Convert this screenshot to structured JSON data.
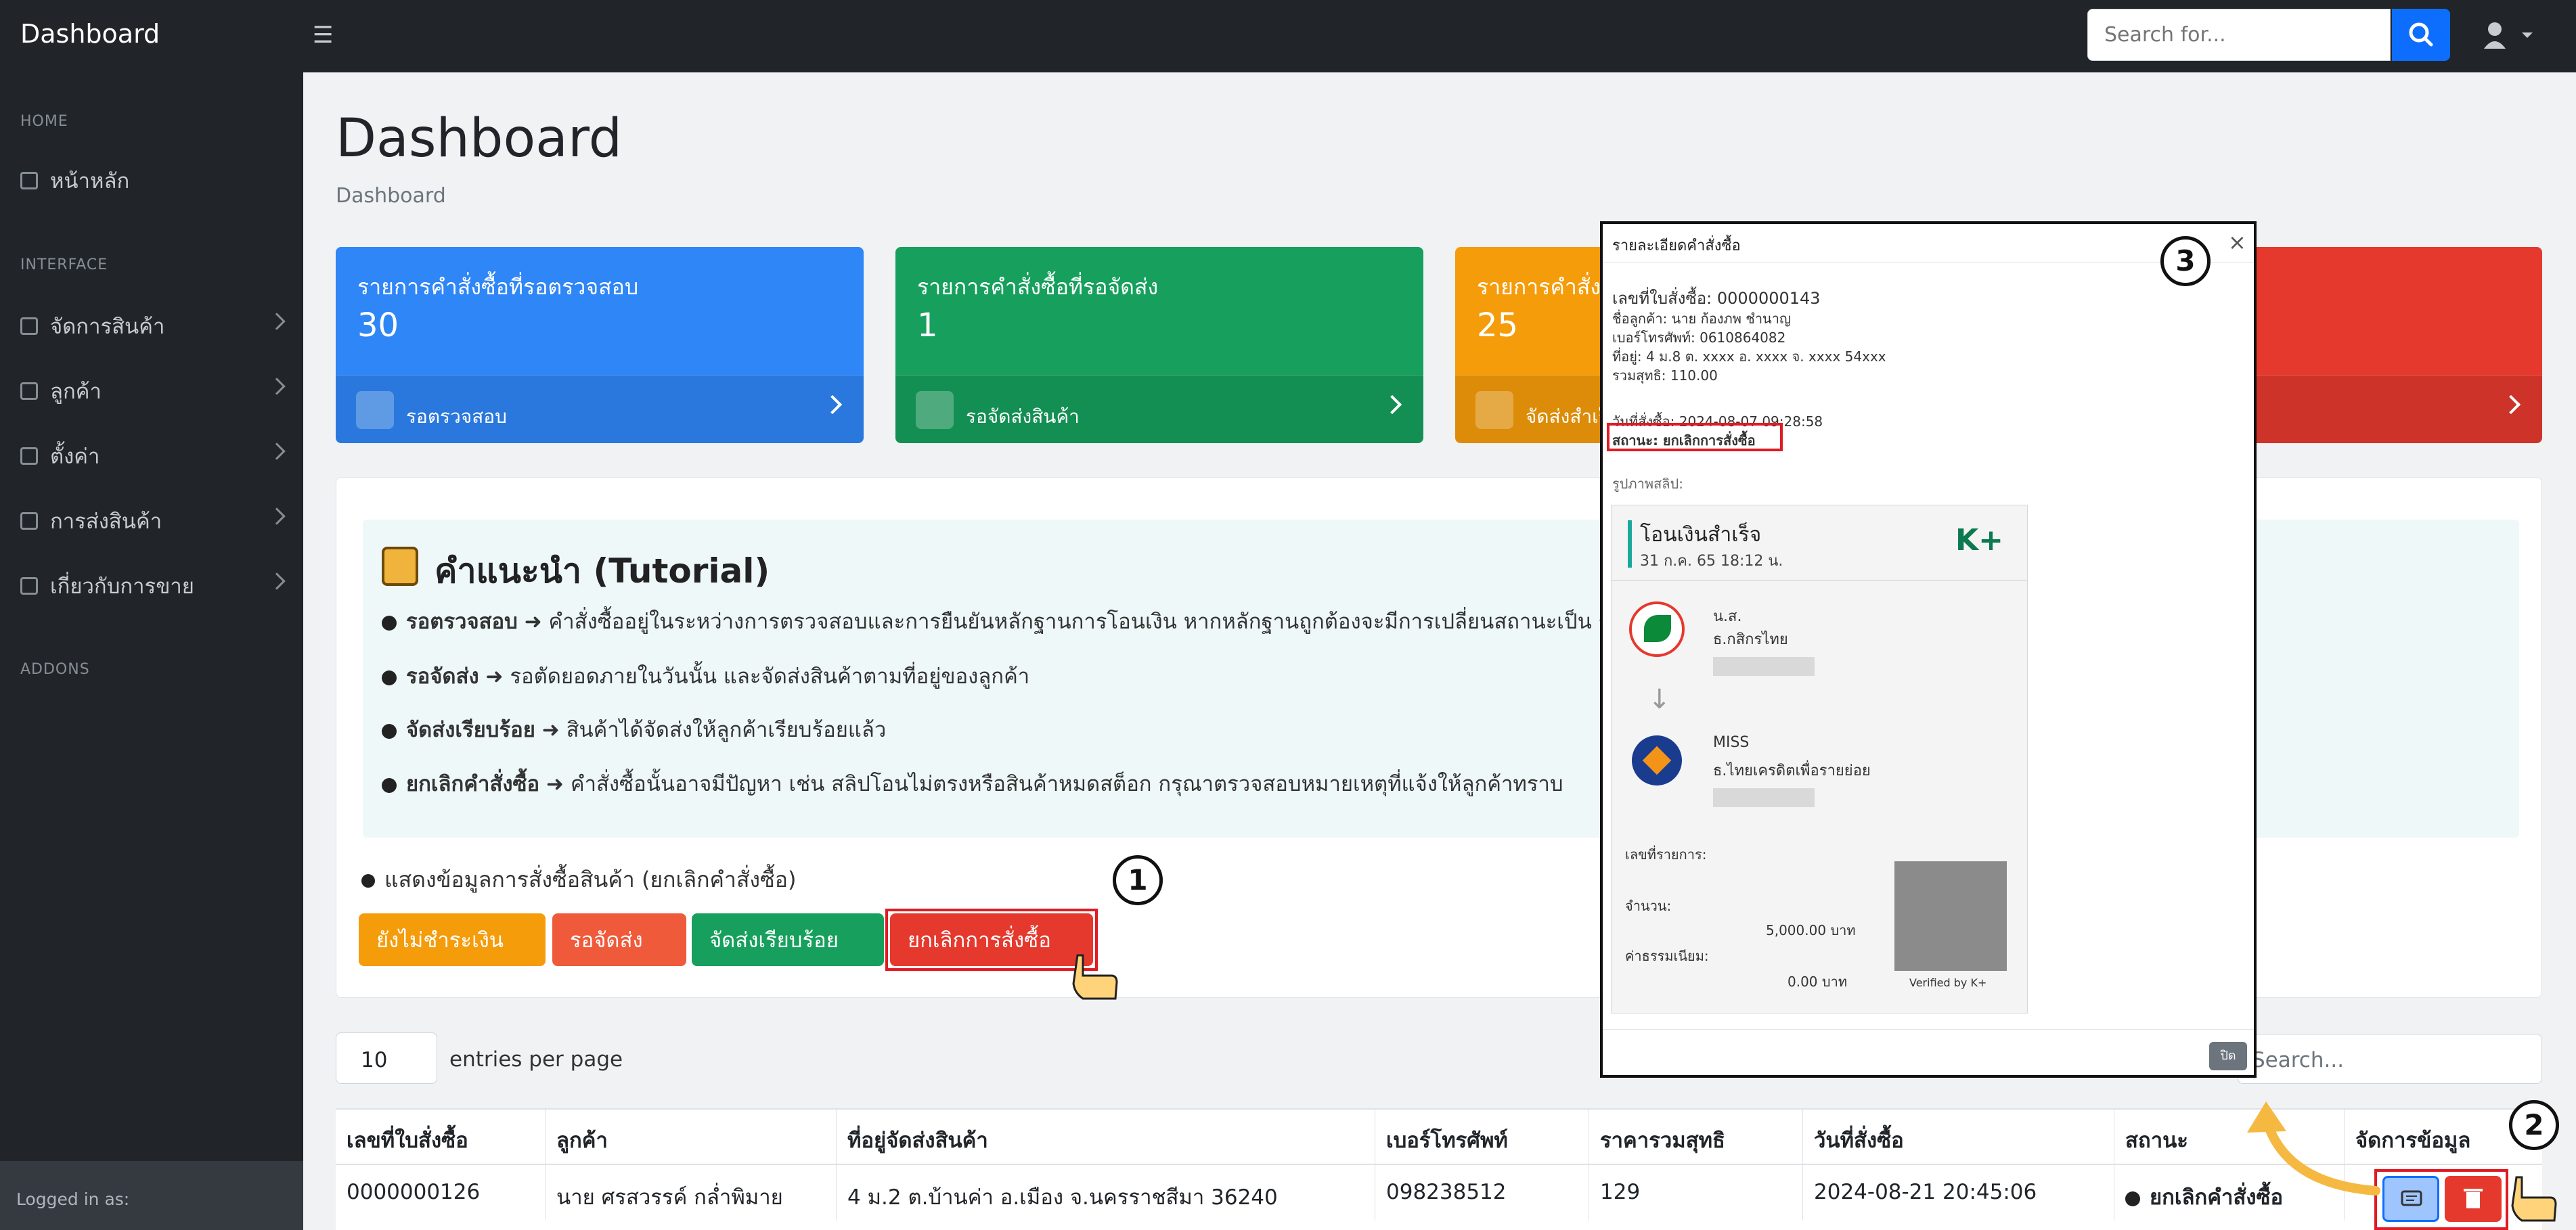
{
  "header": {
    "brand": "Dashboard",
    "search_placeholder": "Search for..."
  },
  "sidebar": {
    "sections": [
      "HOME",
      "INTERFACE",
      "ADDONS"
    ],
    "items": [
      {
        "label": "หน้าหลัก",
        "icon": "home-icon"
      },
      {
        "label": "จัดการสินค้า",
        "icon": "product-icon"
      },
      {
        "label": "ลูกค้า",
        "icon": "customer-icon"
      },
      {
        "label": "ตั้งค่า",
        "icon": "settings-icon"
      },
      {
        "label": "การส่งสินค้า",
        "icon": "shipping-icon"
      },
      {
        "label": "เกี่ยวกับการขาย",
        "icon": "sales-chart-icon"
      }
    ],
    "footer": "Logged in as:"
  },
  "page": {
    "title": "Dashboard",
    "breadcrumb": "Dashboard"
  },
  "cards": [
    {
      "title": "รายการคำสั่งซื้อที่รอตรวจสอบ",
      "value": "30",
      "link": "รอตรวจสอบ",
      "color": "#2f86f6"
    },
    {
      "title": "รายการคำสั่งซื้อที่รอจัดส่ง",
      "value": "1",
      "link": "รอจัดส่งสินค้า",
      "color": "#17a05d"
    },
    {
      "title": "รายการคำสั่ง",
      "value": "25",
      "link": "จัดส่งสำเร็จ",
      "color": "#f59c0b"
    },
    {
      "title": "",
      "value": "",
      "link": "",
      "color": "#e5392d"
    }
  ],
  "tutorial": {
    "title": "คำแนะนำ (Tutorial)",
    "rows": [
      {
        "label": "รอตรวจสอบ",
        "text": "คำสั่งซื้ออยู่ในระหว่างการตรวจสอบและการยืนยันหลักฐานการโอนเงิน หากหลักฐานถูกต้องจะมีการเปลี่ยนสถานะเป็น ร"
      },
      {
        "label": "รอจัดส่ง",
        "text": "รอตัดยอดภายในวันนั้น และจัดส่งสินค้าตามที่อยู่ของลูกค้า"
      },
      {
        "label": "จัดส่งเรียบร้อย",
        "text": "สินค้าได้จัดส่งให้ลูกค้าเรียบร้อยแล้ว"
      },
      {
        "label": "ยกเลิกคำสั่งซื้อ",
        "text": "คำสั่งซื้อนั้นอาจมีปัญหา เช่น สลิปโอนไม่ตรงหรือสินค้าหมดสต็อก กรุณาตรวจสอบหมายเหตุที่แจ้งให้ลูกค้าทราบ"
      }
    ]
  },
  "filter": {
    "note": "แสดงข้อมูลการสั่งซื้อสินค้า (ยกเลิกคำสั่งซื้อ)",
    "buttons": [
      {
        "label": "ยังไม่ชำระเงิน",
        "color": "#f59c0b"
      },
      {
        "label": "รอจัดส่ง",
        "color": "#ef5a3a"
      },
      {
        "label": "จัดส่งเรียบร้อย",
        "color": "#17a05d"
      },
      {
        "label": "ยกเลิกการสั่งซื้อ",
        "color": "#e5392d"
      }
    ]
  },
  "table_controls": {
    "entries_value": "10",
    "entries_label": "entries per page",
    "search_placeholder": "Search..."
  },
  "table": {
    "headers": [
      "เลขที่ใบสั่งซื้อ",
      "ลูกค้า",
      "ที่อยู่จัดส่งสินค้า",
      "เบอร์โทรศัพท์",
      "ราคารวมสุทธิ",
      "วันที่สั่งซื้อ",
      "สถานะ",
      "จัดการข้อมูล"
    ],
    "rows": [
      [
        "0000000126",
        "นาย ศรสวรรค์ กล่ำพิมาย",
        "4 ม.2 ต.บ้านค่า อ.เมือง จ.นครราชสีมา 36240",
        "098238512",
        "129",
        "2024-08-21 20:45:06",
        "ยกเลิกคำสั่งซื้อ",
        ""
      ]
    ]
  },
  "modal": {
    "title": "รายละเอียดคำสั่งซื้อ",
    "order_no": "เลขที่ใบสั่งซื้อ: 0000000143",
    "customer": "ชื่อลูกค้า: นาย ก้องภพ ชำนาญ",
    "phone": "เบอร์โทรศัพท์: 0610864082",
    "address": "ที่อยู่: 4 ม.8 ต. xxxx อ. xxxx จ. xxxx 54xxx",
    "total": "รวมสุทธิ: 110.00",
    "date": "วันที่สั่งซื้อ: 2024-08-07 09:28:58",
    "status": "สถานะ: ยกเลิกการสั่งซื้อ",
    "slip_label": "รูปภาพสลิป:",
    "close": "ปิด",
    "slip": {
      "title": "โอนเงินสำเร็จ",
      "datetime": "31 ก.ค. 65  18:12 น.",
      "brand": "K+",
      "sender": "น.ส.",
      "sender_bank": "ธ.กสิกรไทย",
      "receiver": "MISS",
      "receiver_bank": "ธ.ไทยเครดิตเพื่อรายย่อย",
      "ref_label": "เลขที่รายการ:",
      "amount_label": "จำนวน:",
      "amount": "5,000.00 บาท",
      "fee_label": "ค่าธรรมเนียม:",
      "fee": "0.00 บาท",
      "verified": "Verified by K+"
    }
  },
  "callouts": [
    "1",
    "2",
    "3"
  ],
  "colors": {
    "accent": "#0d6efd",
    "highlight": "#e01b24",
    "arrow": "#f5b942"
  }
}
